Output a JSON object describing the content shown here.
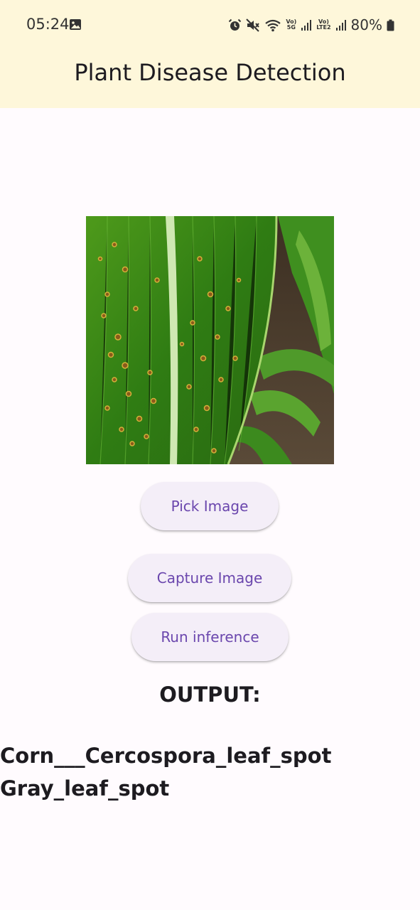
{
  "status_bar": {
    "time": "05:24",
    "battery_percent": "80%",
    "network_1": {
      "top": "Vo)",
      "bottom": "5G"
    },
    "network_2": {
      "top": "Vo)",
      "bottom": "LTE2"
    },
    "icons": [
      "gallery-icon",
      "alarm-icon",
      "mute-icon",
      "wifi-icon",
      "signal-icon",
      "battery-icon"
    ]
  },
  "app_bar": {
    "title": "Plant Disease Detection",
    "background": "#fef7da"
  },
  "actions": {
    "pick_label": "Pick Image",
    "capture_label": "Capture Image",
    "run_label": "Run inference",
    "accent": "#6a46ad"
  },
  "output": {
    "heading": "OUTPUT:",
    "line_1": "Corn___Cercospora_leaf_spot",
    "line_2": "Gray_leaf_spot"
  }
}
